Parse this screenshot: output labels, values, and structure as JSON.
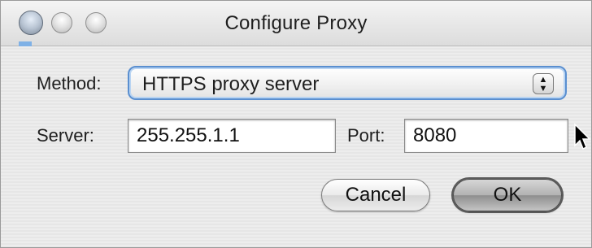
{
  "window": {
    "title": "Configure Proxy"
  },
  "method": {
    "label": "Method:",
    "selected": "HTTPS proxy server"
  },
  "server": {
    "label": "Server:",
    "value": "255.255.1.1"
  },
  "port": {
    "label": "Port:",
    "value": "8080"
  },
  "buttons": {
    "cancel": "Cancel",
    "ok": "OK"
  },
  "icons": {
    "stepper_up": "▲",
    "stepper_down": "▼"
  }
}
